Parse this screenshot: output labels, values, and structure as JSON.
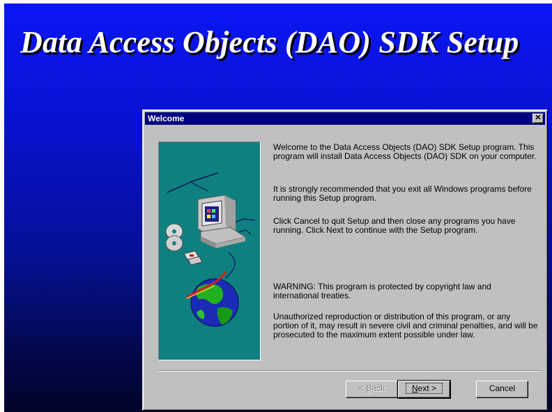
{
  "app": {
    "title": "Data Access Objects (DAO) SDK Setup"
  },
  "dialog": {
    "title": "Welcome",
    "close_glyph": "✕",
    "paragraphs": [
      "Welcome to the Data Access Objects (DAO) SDK Setup program.  This program will install Data Access Objects (DAO) SDK on your computer.",
      "It is strongly recommended that you exit all Windows programs before running this Setup program.",
      "Click Cancel to quit Setup and then close any programs you have running.  Click Next to continue with the Setup program.",
      "WARNING: This program is protected by copyright law and international treaties.",
      "Unauthorized reproduction or distribution of this program, or any portion of it, may result in severe civil and criminal penalties, and will be prosecuted to the maximum extent possible under law."
    ],
    "buttons": {
      "back": {
        "prefix": "< ",
        "mnemonic": "B",
        "rest": "ack",
        "enabled": false
      },
      "next": {
        "mnemonic": "N",
        "rest": "ext >",
        "is_default": true
      },
      "cancel": {
        "label": "Cancel"
      }
    }
  },
  "colors": {
    "desktop_gradient_top": "#0b16f5",
    "desktop_gradient_bottom": "#02042a",
    "dialog_face": "#c0c0c0",
    "titlebar": "#000080",
    "illustration_bg": "#0f8080"
  }
}
